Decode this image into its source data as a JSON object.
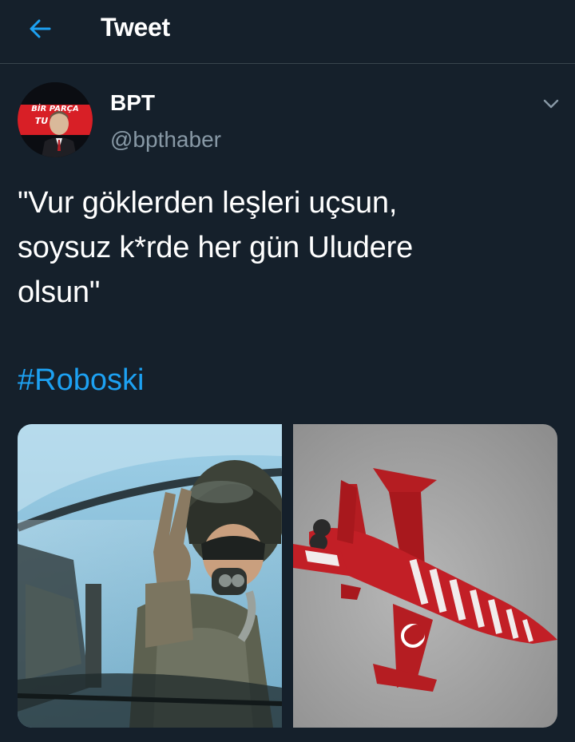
{
  "header": {
    "back_icon": "arrow-left-icon",
    "title": "Tweet"
  },
  "tweet": {
    "author": {
      "name": "BPT",
      "handle": "@bpthaber",
      "avatar_text": "BİR PARÇA"
    },
    "menu_icon": "chevron-down-icon",
    "text_lines": [
      "\"Vur göklerden leşleri uçsun,",
      "soysuz k*rde her gün Uludere",
      "olsun\""
    ],
    "hashtag": "#Roboski",
    "media": [
      {
        "kind": "photo",
        "subject": "pilot-in-cockpit"
      },
      {
        "kind": "photo",
        "subject": "red-white-fighter-jet"
      }
    ]
  },
  "colors": {
    "background": "#15202b",
    "divider": "#38444d",
    "accent": "#1da1f2",
    "secondary_text": "#8899a6"
  }
}
